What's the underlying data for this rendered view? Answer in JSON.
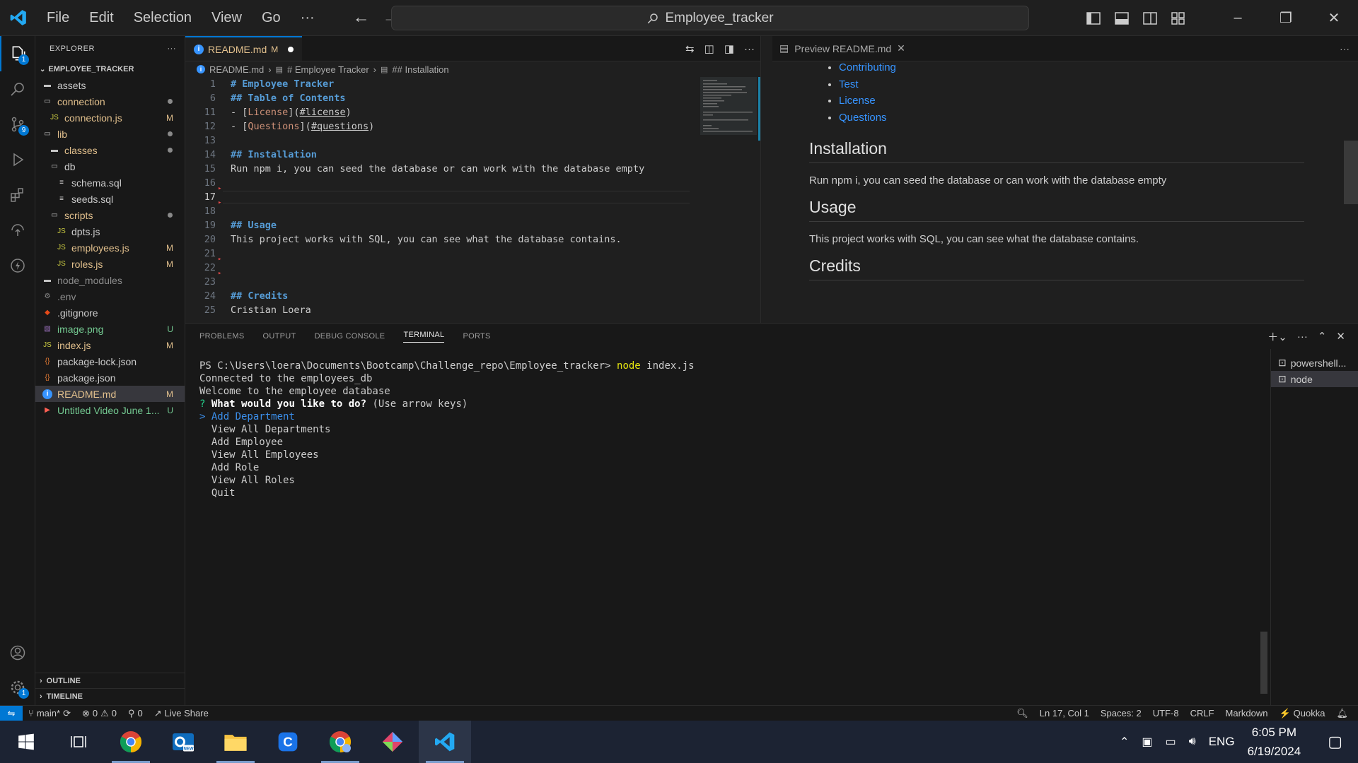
{
  "titlebar": {
    "menu": [
      "File",
      "Edit",
      "Selection",
      "View",
      "Go",
      "···"
    ],
    "search_text": "Employee_tracker"
  },
  "activity": {
    "explorer_badge": "1",
    "scm_badge": "9",
    "settings_badge": "1"
  },
  "explorer": {
    "title": "EXPLORER",
    "project": "EMPLOYEE_TRACKER",
    "items": [
      {
        "label": "assets",
        "indent": 0,
        "kind": "folder",
        "color": "#cccccc",
        "status": ""
      },
      {
        "label": "connection",
        "indent": 0,
        "kind": "folder-open",
        "color": "#e2c08d",
        "status": "dot"
      },
      {
        "label": "connection.js",
        "indent": 1,
        "kind": "js",
        "color": "#e2c08d",
        "status": "M"
      },
      {
        "label": "lib",
        "indent": 0,
        "kind": "folder-open",
        "color": "#e2c08d",
        "status": "dot"
      },
      {
        "label": "classes",
        "indent": 1,
        "kind": "folder",
        "color": "#e2c08d",
        "status": "dot"
      },
      {
        "label": "db",
        "indent": 1,
        "kind": "folder-open",
        "color": "#cccccc",
        "status": ""
      },
      {
        "label": "schema.sql",
        "indent": 2,
        "kind": "db",
        "color": "#cccccc",
        "status": ""
      },
      {
        "label": "seeds.sql",
        "indent": 2,
        "kind": "db",
        "color": "#cccccc",
        "status": ""
      },
      {
        "label": "scripts",
        "indent": 1,
        "kind": "folder-open",
        "color": "#e2c08d",
        "status": "dot"
      },
      {
        "label": "dpts.js",
        "indent": 2,
        "kind": "js",
        "color": "#cccccc",
        "status": ""
      },
      {
        "label": "employees.js",
        "indent": 2,
        "kind": "js",
        "color": "#e2c08d",
        "status": "M"
      },
      {
        "label": "roles.js",
        "indent": 2,
        "kind": "js",
        "color": "#e2c08d",
        "status": "M"
      },
      {
        "label": "node_modules",
        "indent": 0,
        "kind": "folder",
        "color": "#8c8c8c",
        "status": ""
      },
      {
        "label": ".env",
        "indent": 0,
        "kind": "env",
        "color": "#8c8c8c",
        "status": ""
      },
      {
        "label": ".gitignore",
        "indent": 0,
        "kind": "git",
        "color": "#cccccc",
        "status": ""
      },
      {
        "label": "image.png",
        "indent": 0,
        "kind": "img",
        "color": "#73c991",
        "status": "U"
      },
      {
        "label": "index.js",
        "indent": 0,
        "kind": "js",
        "color": "#e2c08d",
        "status": "M"
      },
      {
        "label": "package-lock.json",
        "indent": 0,
        "kind": "json",
        "color": "#cccccc",
        "status": ""
      },
      {
        "label": "package.json",
        "indent": 0,
        "kind": "json",
        "color": "#cccccc",
        "status": ""
      },
      {
        "label": "README.md",
        "indent": 0,
        "kind": "info",
        "color": "#e2c08d",
        "status": "M",
        "selected": true
      },
      {
        "label": "Untitled Video June 1...",
        "indent": 0,
        "kind": "video",
        "color": "#73c991",
        "status": "U"
      }
    ],
    "outline": "OUTLINE",
    "timeline": "TIMELINE"
  },
  "editor": {
    "tab_label": "README.md",
    "tab_status": "M",
    "breadcrumb": [
      "README.md",
      "# Employee Tracker",
      "## Installation"
    ],
    "lines": [
      {
        "n": "1",
        "parts": [
          [
            "h",
            "# Employee Tracker"
          ]
        ]
      },
      {
        "n": "6",
        "parts": [
          [
            "h",
            "## Table of Contents"
          ]
        ]
      },
      {
        "n": "11",
        "parts": [
          [
            "t",
            "- ["
          ],
          [
            "lnk",
            "License"
          ],
          [
            "t",
            "]("
          ],
          [
            "url",
            "#license"
          ],
          [
            "t",
            ")"
          ]
        ]
      },
      {
        "n": "12",
        "parts": [
          [
            "t",
            "- ["
          ],
          [
            "lnk",
            "Questions"
          ],
          [
            "t",
            "]("
          ],
          [
            "url",
            "#questions"
          ],
          [
            "t",
            ")"
          ]
        ]
      },
      {
        "n": "13",
        "parts": []
      },
      {
        "n": "14",
        "parts": [
          [
            "h",
            "## Installation"
          ]
        ]
      },
      {
        "n": "15",
        "parts": [
          [
            "t",
            "Run npm i, you can seed the database or can work with the database empty"
          ]
        ]
      },
      {
        "n": "16",
        "parts": []
      },
      {
        "n": "17",
        "parts": [],
        "current": true
      },
      {
        "n": "18",
        "parts": []
      },
      {
        "n": "19",
        "parts": [
          [
            "h",
            "## Usage"
          ]
        ]
      },
      {
        "n": "20",
        "parts": [
          [
            "t",
            "This project works with SQL, you can see what the database contains."
          ]
        ]
      },
      {
        "n": "21",
        "parts": []
      },
      {
        "n": "22",
        "parts": []
      },
      {
        "n": "23",
        "parts": []
      },
      {
        "n": "24",
        "parts": [
          [
            "h",
            "## Credits"
          ]
        ]
      },
      {
        "n": "25",
        "parts": [
          [
            "t",
            "Cristian Loera"
          ]
        ]
      }
    ]
  },
  "preview": {
    "tab_label": "Preview README.md",
    "links": [
      "Contributing",
      "Test",
      "License",
      "Questions"
    ],
    "h_installation": "Installation",
    "p_installation": "Run npm i, you can seed the database or can work with the database empty",
    "h_usage": "Usage",
    "p_usage": "This project works with SQL, you can see what the database contains.",
    "h_credits": "Credits"
  },
  "panel": {
    "tabs": [
      "PROBLEMS",
      "OUTPUT",
      "DEBUG CONSOLE",
      "TERMINAL",
      "PORTS"
    ],
    "active_tab": "TERMINAL",
    "prompt": "PS C:\\Users\\loera\\Documents\\Bootcamp\\Challenge_repo\\Employee_tracker> ",
    "cmd": "node",
    "cmd_arg": " index.js",
    "output": [
      "Connected to the employees_db",
      "Welcome to the employee database"
    ],
    "question_mark": "?",
    "question": "What would you like to do?",
    "hint": " (Use arrow keys)",
    "choices": [
      {
        "label": "Add Department",
        "selected": true
      },
      {
        "label": "View All Departments"
      },
      {
        "label": "Add Employee"
      },
      {
        "label": "View All Employees"
      },
      {
        "label": "Add Role"
      },
      {
        "label": "View All Roles"
      },
      {
        "label": "Quit"
      }
    ],
    "terminals": [
      "powershell...",
      "node"
    ]
  },
  "statusbar": {
    "branch": "main*",
    "errors": "0",
    "warnings": "0",
    "ports": "0",
    "live_share": "Live Share",
    "position": "Ln 17, Col 1",
    "spaces": "Spaces: 2",
    "encoding": "UTF-8",
    "eol": "CRLF",
    "language": "Markdown",
    "quokka": "Quokka"
  },
  "taskbar": {
    "language": "ENG",
    "time": "6:05 PM",
    "date": "6/19/2024"
  }
}
